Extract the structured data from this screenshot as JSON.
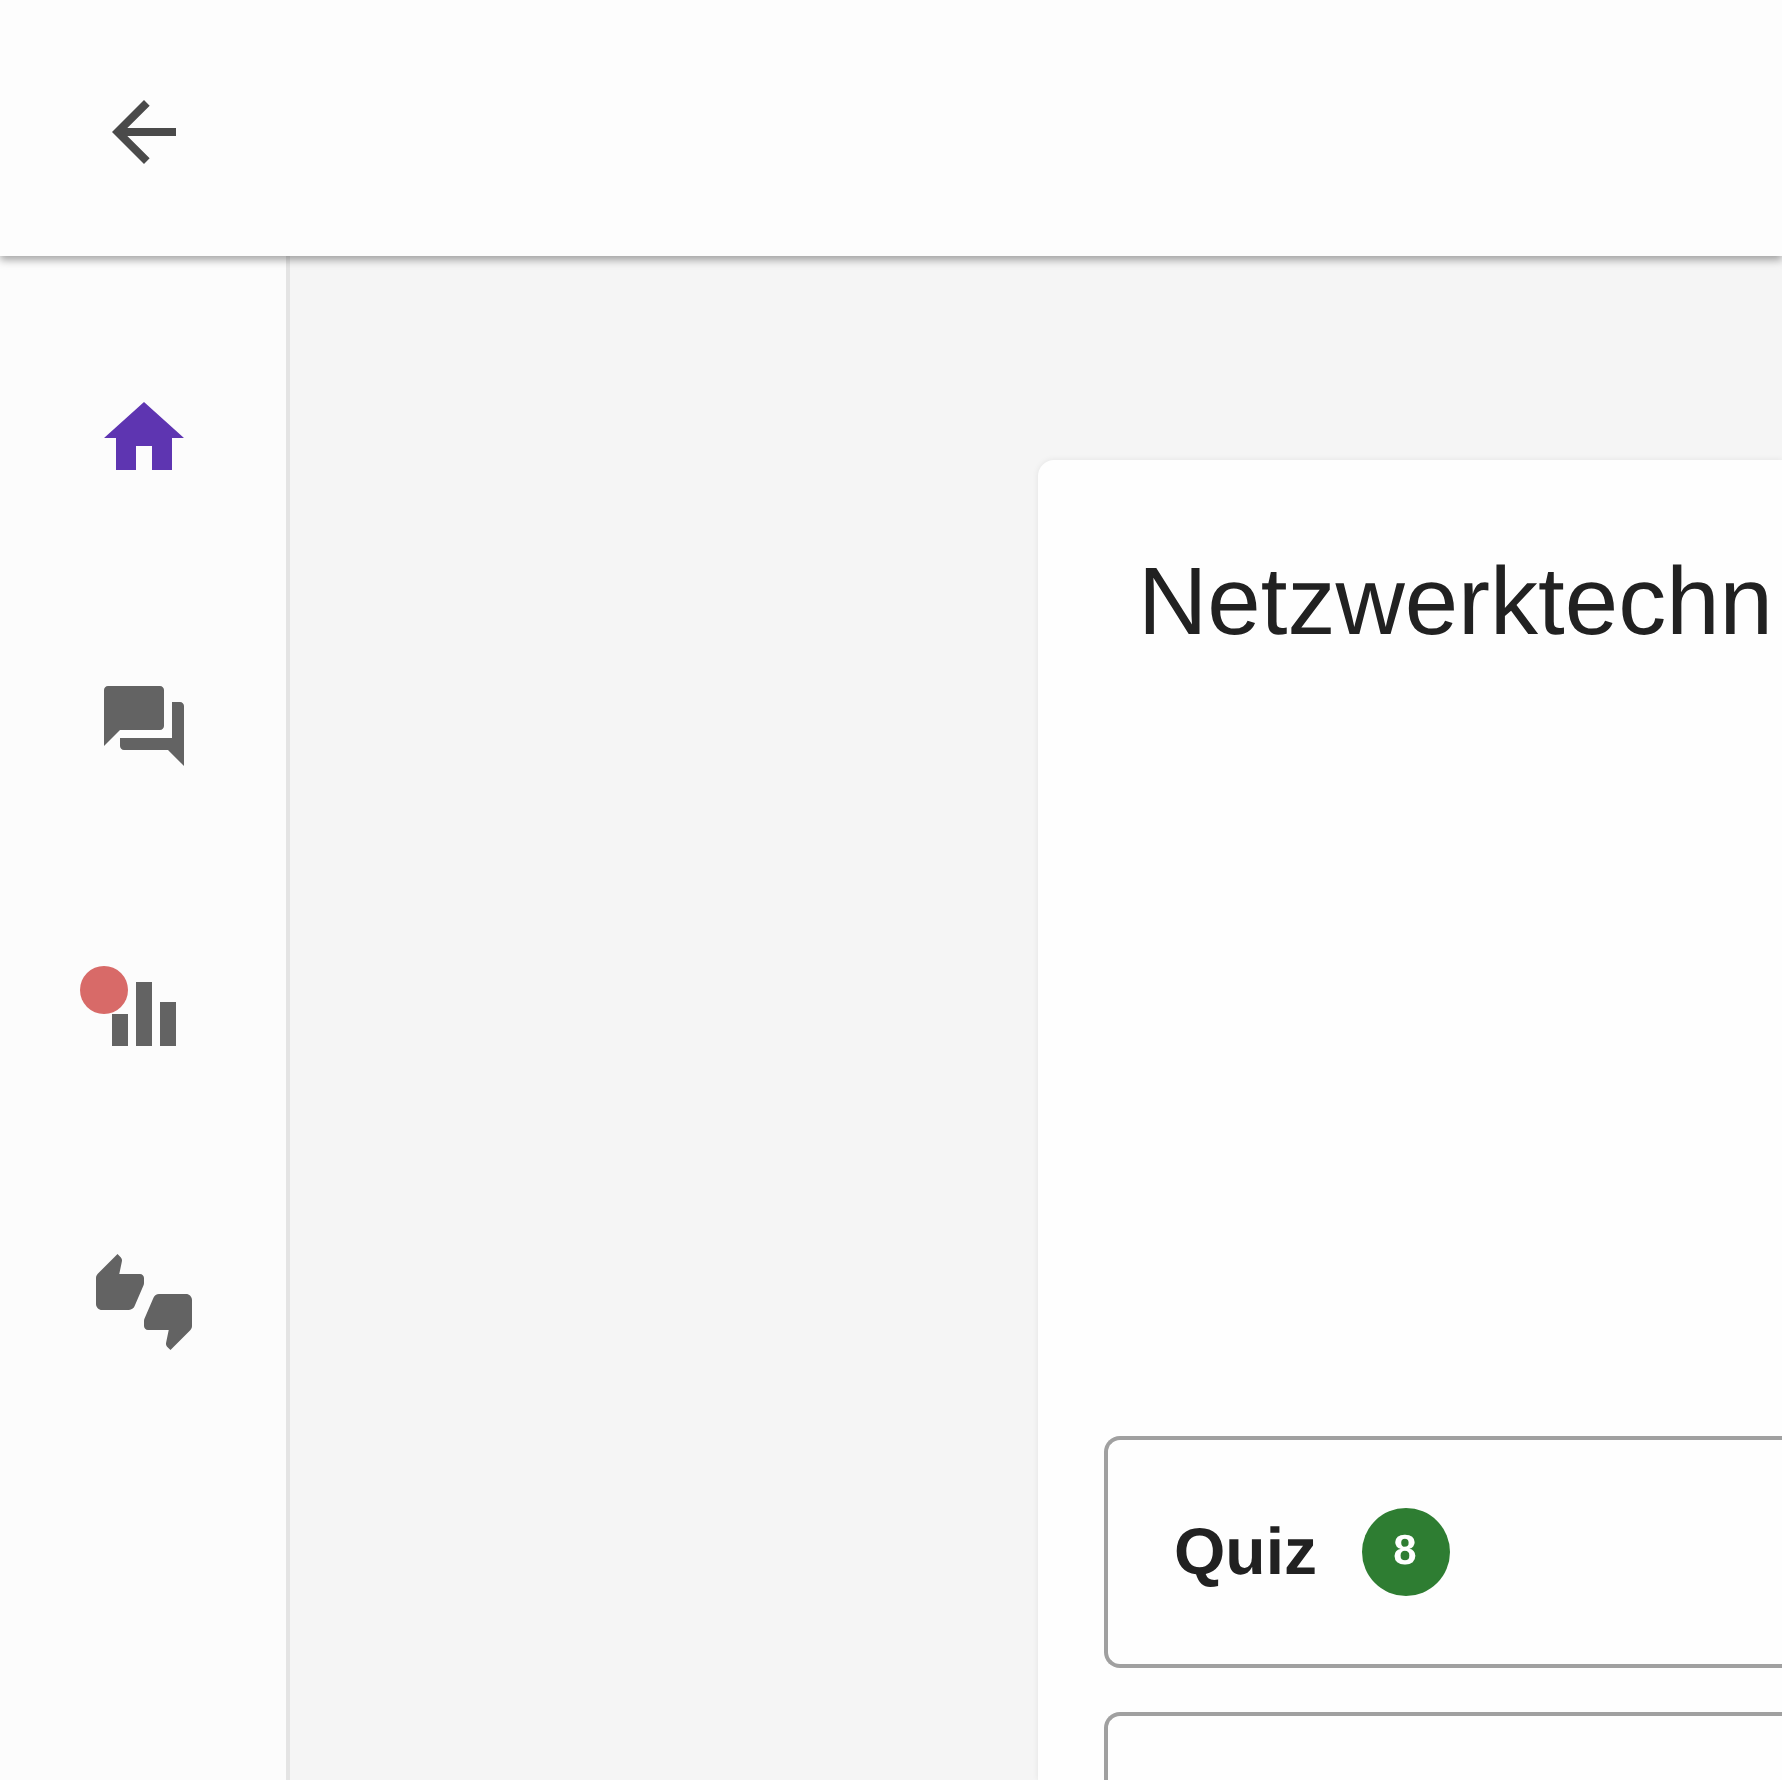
{
  "sidebar": {
    "items": [
      {
        "kind": "home",
        "selected": true,
        "badge": false
      },
      {
        "kind": "chat",
        "selected": false,
        "badge": false
      },
      {
        "kind": "stats",
        "selected": false,
        "badge": true
      },
      {
        "kind": "feedback",
        "selected": false,
        "badge": false
      }
    ]
  },
  "card": {
    "title": "Netzwerktechn",
    "sections": [
      {
        "kind": "titled",
        "label": "Quiz",
        "count": "8"
      },
      {
        "kind": "blank"
      }
    ]
  }
}
